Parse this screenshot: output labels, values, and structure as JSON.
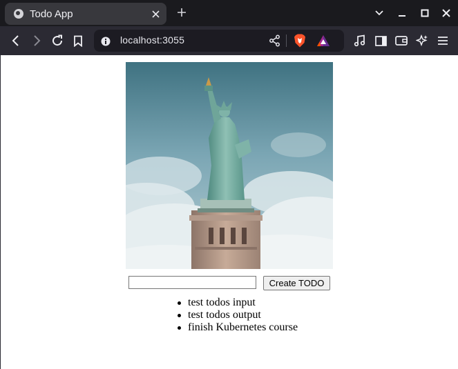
{
  "browser": {
    "tab_title": "Todo App",
    "url": "localhost:3055"
  },
  "todo_form": {
    "input_value": "",
    "create_label": "Create TODO"
  },
  "todos": [
    {
      "text": "test todos input"
    },
    {
      "text": "test todos output"
    },
    {
      "text": "finish Kubernetes course"
    }
  ],
  "colors": {
    "tabbar_bg": "#1a1a1e",
    "toolbar_bg": "#2b2a33",
    "urlbar_bg": "#1c1b22",
    "brave_orange": "#fb542b"
  }
}
